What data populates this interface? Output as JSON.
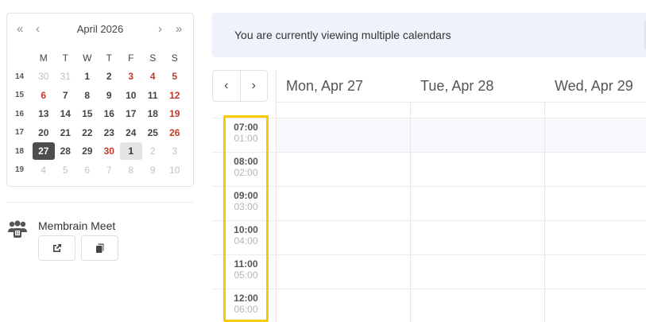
{
  "mini_calendar": {
    "title": "April 2026",
    "prev_year": "«",
    "prev_month": "‹",
    "next_month": "›",
    "next_year": "»",
    "weekdays": [
      "M",
      "T",
      "W",
      "T",
      "F",
      "S",
      "S"
    ],
    "weeks": [
      {
        "num": "14",
        "days": [
          {
            "d": "30",
            "type": "other"
          },
          {
            "d": "31",
            "type": "other"
          },
          {
            "d": "1",
            "type": "bold"
          },
          {
            "d": "2",
            "type": "bold"
          },
          {
            "d": "3",
            "type": "weekend"
          },
          {
            "d": "4",
            "type": "weekend"
          },
          {
            "d": "5",
            "type": "weekend"
          }
        ]
      },
      {
        "num": "15",
        "days": [
          {
            "d": "6",
            "type": "weekend"
          },
          {
            "d": "7",
            "type": "bold"
          },
          {
            "d": "8",
            "type": "bold"
          },
          {
            "d": "9",
            "type": "bold"
          },
          {
            "d": "10",
            "type": "bold"
          },
          {
            "d": "11",
            "type": "bold"
          },
          {
            "d": "12",
            "type": "weekend"
          }
        ]
      },
      {
        "num": "16",
        "days": [
          {
            "d": "13",
            "type": "bold"
          },
          {
            "d": "14",
            "type": "bold"
          },
          {
            "d": "15",
            "type": "bold"
          },
          {
            "d": "16",
            "type": "bold"
          },
          {
            "d": "17",
            "type": "bold"
          },
          {
            "d": "18",
            "type": "bold"
          },
          {
            "d": "19",
            "type": "weekend"
          }
        ]
      },
      {
        "num": "17",
        "days": [
          {
            "d": "20",
            "type": "bold"
          },
          {
            "d": "21",
            "type": "bold"
          },
          {
            "d": "22",
            "type": "bold"
          },
          {
            "d": "23",
            "type": "bold"
          },
          {
            "d": "24",
            "type": "bold"
          },
          {
            "d": "25",
            "type": "bold"
          },
          {
            "d": "26",
            "type": "weekend"
          }
        ]
      },
      {
        "num": "18",
        "days": [
          {
            "d": "27",
            "type": "today"
          },
          {
            "d": "28",
            "type": "bold"
          },
          {
            "d": "29",
            "type": "bold"
          },
          {
            "d": "30",
            "type": "weekend"
          },
          {
            "d": "1",
            "type": "selected"
          },
          {
            "d": "2",
            "type": "other"
          },
          {
            "d": "3",
            "type": "other"
          }
        ]
      },
      {
        "num": "19",
        "days": [
          {
            "d": "4",
            "type": "other"
          },
          {
            "d": "5",
            "type": "other"
          },
          {
            "d": "6",
            "type": "other"
          },
          {
            "d": "7",
            "type": "other"
          },
          {
            "d": "8",
            "type": "other"
          },
          {
            "d": "9",
            "type": "other"
          },
          {
            "d": "10",
            "type": "other"
          }
        ]
      }
    ]
  },
  "meet": {
    "title": "Membrain Meet",
    "icon": "people-meeting-icon",
    "open_icon": "external-link-icon",
    "copy_icon": "copy-icon"
  },
  "banner": {
    "text": "You are currently viewing multiple calendars"
  },
  "week_nav": {
    "prev": "‹",
    "next": "›"
  },
  "days": [
    "Mon, Apr 27",
    "Tue, Apr 28",
    "Wed, Apr 29"
  ],
  "time_slots": [
    {
      "main": "07:00",
      "sub": "01:00"
    },
    {
      "main": "08:00",
      "sub": "02:00"
    },
    {
      "main": "09:00",
      "sub": "03:00"
    },
    {
      "main": "10:00",
      "sub": "04:00"
    },
    {
      "main": "11:00",
      "sub": "05:00"
    },
    {
      "main": "12:00",
      "sub": "06:00"
    }
  ],
  "colors": {
    "today_bg": "#4d4d4d",
    "weekend": "#c0392b",
    "banner_bg": "#eef2fb",
    "highlight_border": "#f5cc00"
  }
}
